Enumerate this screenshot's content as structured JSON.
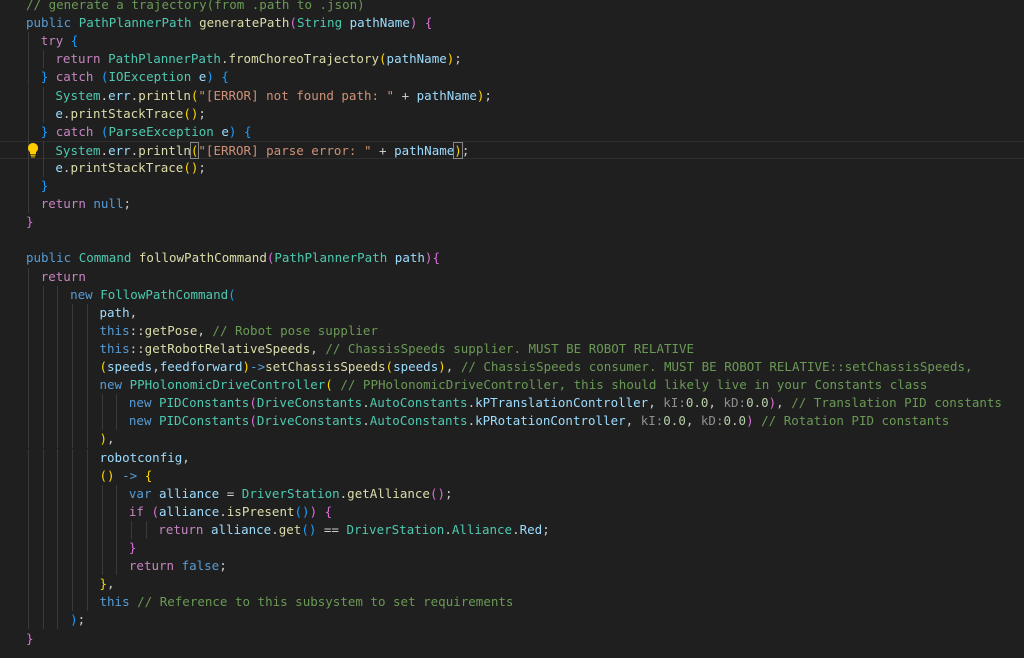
{
  "colors": {
    "background": "#1f1f1f",
    "plain": "#cccccc",
    "keyword": "#c586c0",
    "storage": "#569cd6",
    "type": "#4ec9b0",
    "function": "#dcdcaa",
    "variable": "#9cdcfe",
    "string": "#ce9178",
    "comment": "#6a9955",
    "bracket1": "#ffd700",
    "bracket2": "#da70d6",
    "bracket3": "#179fff",
    "lightbulb": "#ffcc00"
  },
  "editor": {
    "lightbulb_icon": "lightbulb-icon",
    "lines": [
      {
        "indent": 0,
        "current": false,
        "tokens": [
          [
            "// generate a trajectory(from .path to .json)",
            "c"
          ]
        ]
      },
      {
        "indent": 0,
        "current": false,
        "tokens": [
          [
            "public",
            "s"
          ],
          [
            " ",
            "p"
          ],
          [
            "PathPlannerPath",
            "t"
          ],
          [
            " ",
            "p"
          ],
          [
            "generatePath",
            "f"
          ],
          [
            "(",
            "b2"
          ],
          [
            "String",
            "t"
          ],
          [
            " ",
            "p"
          ],
          [
            "pathName",
            "v"
          ],
          [
            ")",
            "b2"
          ],
          [
            " ",
            "p"
          ],
          [
            "{",
            "b2"
          ]
        ]
      },
      {
        "indent": 1,
        "current": false,
        "tokens": [
          [
            "try",
            "k"
          ],
          [
            " ",
            "p"
          ],
          [
            "{",
            "b3"
          ]
        ]
      },
      {
        "indent": 2,
        "current": false,
        "tokens": [
          [
            "return",
            "k"
          ],
          [
            " ",
            "p"
          ],
          [
            "PathPlannerPath",
            "t"
          ],
          [
            ".",
            "p"
          ],
          [
            "fromChoreoTrajectory",
            "f"
          ],
          [
            "(",
            "b1"
          ],
          [
            "pathName",
            "v"
          ],
          [
            ")",
            "b1"
          ],
          [
            ";",
            "p"
          ]
        ]
      },
      {
        "indent": 1,
        "current": false,
        "tokens": [
          [
            "}",
            "b3"
          ],
          [
            " ",
            "p"
          ],
          [
            "catch",
            "k"
          ],
          [
            " ",
            "p"
          ],
          [
            "(",
            "b3"
          ],
          [
            "IOException",
            "t"
          ],
          [
            " ",
            "p"
          ],
          [
            "e",
            "v"
          ],
          [
            ")",
            "b3"
          ],
          [
            " ",
            "p"
          ],
          [
            "{",
            "b3"
          ]
        ]
      },
      {
        "indent": 2,
        "current": false,
        "tokens": [
          [
            "System",
            "t"
          ],
          [
            ".",
            "p"
          ],
          [
            "err",
            "v"
          ],
          [
            ".",
            "p"
          ],
          [
            "println",
            "f"
          ],
          [
            "(",
            "b1"
          ],
          [
            "\"[ERROR] not found path: \"",
            "st"
          ],
          [
            " + ",
            "p"
          ],
          [
            "pathName",
            "v"
          ],
          [
            ")",
            "b1"
          ],
          [
            ";",
            "p"
          ]
        ]
      },
      {
        "indent": 2,
        "current": false,
        "tokens": [
          [
            "e",
            "v"
          ],
          [
            ".",
            "p"
          ],
          [
            "printStackTrace",
            "f"
          ],
          [
            "(",
            "b1"
          ],
          [
            ")",
            "b1"
          ],
          [
            ";",
            "p"
          ]
        ]
      },
      {
        "indent": 1,
        "current": false,
        "tokens": [
          [
            "}",
            "b3"
          ],
          [
            " ",
            "p"
          ],
          [
            "catch",
            "k"
          ],
          [
            " ",
            "p"
          ],
          [
            "(",
            "b3"
          ],
          [
            "ParseException",
            "t"
          ],
          [
            " ",
            "p"
          ],
          [
            "e",
            "v"
          ],
          [
            ")",
            "b3"
          ],
          [
            " ",
            "p"
          ],
          [
            "{",
            "b3"
          ]
        ]
      },
      {
        "indent": 2,
        "current": true,
        "tokens": [
          [
            "System",
            "t"
          ],
          [
            ".",
            "p"
          ],
          [
            "err",
            "v"
          ],
          [
            ".",
            "p"
          ],
          [
            "println",
            "f"
          ],
          [
            "(",
            "b1x"
          ],
          [
            "\"[ERROR] parse error: \"",
            "st"
          ],
          [
            " + ",
            "p"
          ],
          [
            "pathName",
            "v"
          ],
          [
            ")",
            "b1x"
          ],
          [
            ";",
            "p"
          ]
        ]
      },
      {
        "indent": 2,
        "current": false,
        "tokens": [
          [
            "e",
            "v"
          ],
          [
            ".",
            "p"
          ],
          [
            "printStackTrace",
            "f"
          ],
          [
            "(",
            "b1"
          ],
          [
            ")",
            "b1"
          ],
          [
            ";",
            "p"
          ]
        ]
      },
      {
        "indent": 1,
        "current": false,
        "tokens": [
          [
            "}",
            "b3"
          ]
        ]
      },
      {
        "indent": 1,
        "current": false,
        "tokens": [
          [
            "return",
            "k"
          ],
          [
            " ",
            "p"
          ],
          [
            "null",
            "s"
          ],
          [
            ";",
            "p"
          ]
        ]
      },
      {
        "indent": 0,
        "current": false,
        "tokens": [
          [
            "}",
            "b2"
          ]
        ]
      },
      {
        "indent": 0,
        "current": false,
        "tokens": []
      },
      {
        "indent": 0,
        "current": false,
        "tokens": [
          [
            "public",
            "s"
          ],
          [
            " ",
            "p"
          ],
          [
            "Command",
            "t"
          ],
          [
            " ",
            "p"
          ],
          [
            "followPathCommand",
            "f"
          ],
          [
            "(",
            "b2"
          ],
          [
            "PathPlannerPath",
            "t"
          ],
          [
            " ",
            "p"
          ],
          [
            "path",
            "v"
          ],
          [
            ")",
            "b2"
          ],
          [
            "{",
            "b2"
          ]
        ]
      },
      {
        "indent": 1,
        "current": false,
        "tokens": [
          [
            "return",
            "k"
          ]
        ]
      },
      {
        "indent": 3,
        "current": false,
        "tokens": [
          [
            "new",
            "s"
          ],
          [
            " ",
            "p"
          ],
          [
            "FollowPathCommand",
            "t"
          ],
          [
            "(",
            "b3"
          ]
        ]
      },
      {
        "indent": 5,
        "current": false,
        "tokens": [
          [
            "path",
            "v"
          ],
          [
            ",",
            "p"
          ]
        ]
      },
      {
        "indent": 5,
        "current": false,
        "tokens": [
          [
            "this",
            "s"
          ],
          [
            "::",
            "p"
          ],
          [
            "getPose",
            "f"
          ],
          [
            ", ",
            "p"
          ],
          [
            "// Robot pose supplier",
            "c"
          ]
        ]
      },
      {
        "indent": 5,
        "current": false,
        "tokens": [
          [
            "this",
            "s"
          ],
          [
            "::",
            "p"
          ],
          [
            "getRobotRelativeSpeeds",
            "f"
          ],
          [
            ", ",
            "p"
          ],
          [
            "// ChassisSpeeds supplier. MUST BE ROBOT RELATIVE",
            "c"
          ]
        ]
      },
      {
        "indent": 5,
        "current": false,
        "tokens": [
          [
            "(",
            "b1"
          ],
          [
            "speeds",
            "v"
          ],
          [
            ",",
            "p"
          ],
          [
            "feedforward",
            "v"
          ],
          [
            ")",
            "b1"
          ],
          [
            "->",
            "s"
          ],
          [
            "setChassisSpeeds",
            "f"
          ],
          [
            "(",
            "b1"
          ],
          [
            "speeds",
            "v"
          ],
          [
            ")",
            "b1"
          ],
          [
            ", ",
            "p"
          ],
          [
            "// ChassisSpeeds consumer. MUST BE ROBOT RELATIVE::setChassisSpeeds,",
            "c"
          ]
        ]
      },
      {
        "indent": 5,
        "current": false,
        "tokens": [
          [
            "new",
            "s"
          ],
          [
            " ",
            "p"
          ],
          [
            "PPHolonomicDriveController",
            "t"
          ],
          [
            "(",
            "b1"
          ],
          [
            " ",
            "p"
          ],
          [
            "// PPHolonomicDriveController, this should likely live in your Constants class",
            "c"
          ]
        ]
      },
      {
        "indent": 7,
        "current": false,
        "tokens": [
          [
            "new",
            "s"
          ],
          [
            " ",
            "p"
          ],
          [
            "PIDConstants",
            "t"
          ],
          [
            "(",
            "b2"
          ],
          [
            "DriveConstants",
            "t"
          ],
          [
            ".",
            "p"
          ],
          [
            "AutoConstants",
            "t"
          ],
          [
            ".",
            "p"
          ],
          [
            "kPTranslationController",
            "v"
          ],
          [
            ", ",
            "p"
          ],
          [
            "kI:",
            "h"
          ],
          [
            "0.0",
            "n"
          ],
          [
            ", ",
            "p"
          ],
          [
            "kD:",
            "h"
          ],
          [
            "0.0",
            "n"
          ],
          [
            ")",
            "b2"
          ],
          [
            ", ",
            "p"
          ],
          [
            "// Translation PID constants",
            "c"
          ]
        ]
      },
      {
        "indent": 7,
        "current": false,
        "tokens": [
          [
            "new",
            "s"
          ],
          [
            " ",
            "p"
          ],
          [
            "PIDConstants",
            "t"
          ],
          [
            "(",
            "b2"
          ],
          [
            "DriveConstants",
            "t"
          ],
          [
            ".",
            "p"
          ],
          [
            "AutoConstants",
            "t"
          ],
          [
            ".",
            "p"
          ],
          [
            "kPRotationController",
            "v"
          ],
          [
            ", ",
            "p"
          ],
          [
            "kI:",
            "h"
          ],
          [
            "0.0",
            "n"
          ],
          [
            ", ",
            "p"
          ],
          [
            "kD:",
            "h"
          ],
          [
            "0.0",
            "n"
          ],
          [
            ")",
            "b2"
          ],
          [
            " ",
            "p"
          ],
          [
            "// Rotation PID constants",
            "c"
          ]
        ]
      },
      {
        "indent": 5,
        "current": false,
        "tokens": [
          [
            ")",
            "b1"
          ],
          [
            ",",
            "p"
          ]
        ]
      },
      {
        "indent": 5,
        "current": false,
        "tokens": [
          [
            "robotconfig",
            "v"
          ],
          [
            ",",
            "p"
          ]
        ]
      },
      {
        "indent": 5,
        "current": false,
        "tokens": [
          [
            "(",
            "b1"
          ],
          [
            ")",
            "b1"
          ],
          [
            " ",
            "p"
          ],
          [
            "->",
            "s"
          ],
          [
            " ",
            "p"
          ],
          [
            "{",
            "b1"
          ]
        ]
      },
      {
        "indent": 7,
        "current": false,
        "tokens": [
          [
            "var",
            "s"
          ],
          [
            " ",
            "p"
          ],
          [
            "alliance",
            "v"
          ],
          [
            " = ",
            "p"
          ],
          [
            "DriverStation",
            "t"
          ],
          [
            ".",
            "p"
          ],
          [
            "getAlliance",
            "f"
          ],
          [
            "(",
            "b2"
          ],
          [
            ")",
            "b2"
          ],
          [
            ";",
            "p"
          ]
        ]
      },
      {
        "indent": 7,
        "current": false,
        "tokens": [
          [
            "if",
            "k"
          ],
          [
            " ",
            "p"
          ],
          [
            "(",
            "b2"
          ],
          [
            "alliance",
            "v"
          ],
          [
            ".",
            "p"
          ],
          [
            "isPresent",
            "f"
          ],
          [
            "(",
            "b3"
          ],
          [
            ")",
            "b3"
          ],
          [
            ")",
            "b2"
          ],
          [
            " ",
            "p"
          ],
          [
            "{",
            "b2"
          ]
        ]
      },
      {
        "indent": 9,
        "current": false,
        "tokens": [
          [
            "return",
            "k"
          ],
          [
            " ",
            "p"
          ],
          [
            "alliance",
            "v"
          ],
          [
            ".",
            "p"
          ],
          [
            "get",
            "f"
          ],
          [
            "(",
            "b3"
          ],
          [
            ")",
            "b3"
          ],
          [
            " == ",
            "p"
          ],
          [
            "DriverStation",
            "t"
          ],
          [
            ".",
            "p"
          ],
          [
            "Alliance",
            "t"
          ],
          [
            ".",
            "p"
          ],
          [
            "Red",
            "v"
          ],
          [
            ";",
            "p"
          ]
        ]
      },
      {
        "indent": 7,
        "current": false,
        "tokens": [
          [
            "}",
            "b2"
          ]
        ]
      },
      {
        "indent": 7,
        "current": false,
        "tokens": [
          [
            "return",
            "k"
          ],
          [
            " ",
            "p"
          ],
          [
            "false",
            "s"
          ],
          [
            ";",
            "p"
          ]
        ]
      },
      {
        "indent": 5,
        "current": false,
        "tokens": [
          [
            "}",
            "b1"
          ],
          [
            ",",
            "p"
          ]
        ]
      },
      {
        "indent": 5,
        "current": false,
        "tokens": [
          [
            "this",
            "s"
          ],
          [
            " ",
            "p"
          ],
          [
            "// Reference to this subsystem to set requirements",
            "c"
          ]
        ]
      },
      {
        "indent": 3,
        "current": false,
        "tokens": [
          [
            ")",
            "b3"
          ],
          [
            ";",
            "p"
          ]
        ]
      },
      {
        "indent": 0,
        "current": false,
        "tokens": [
          [
            "}",
            "b2"
          ]
        ]
      }
    ]
  }
}
